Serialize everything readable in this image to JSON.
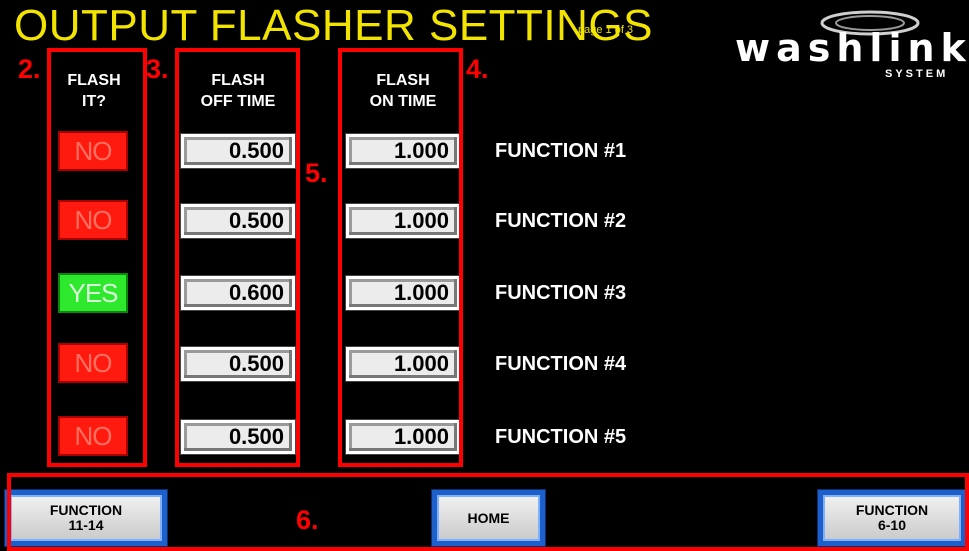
{
  "header": {
    "title": "OUTPUT FLASHER SETTINGS",
    "page_indicator": "page 1 of 3",
    "logo_text": "washlink",
    "logo_subtext": "SYSTEM"
  },
  "columns": {
    "flash_it": [
      "FLASH",
      "IT?"
    ],
    "flash_off": [
      "FLASH",
      "OFF TIME"
    ],
    "flash_on": [
      "FLASH",
      "ON TIME"
    ]
  },
  "rows": [
    {
      "flash_it": "NO",
      "off_time": "0.500",
      "on_time": "1.000",
      "function": "FUNCTION #1"
    },
    {
      "flash_it": "NO",
      "off_time": "0.500",
      "on_time": "1.000",
      "function": "FUNCTION #2"
    },
    {
      "flash_it": "YES",
      "off_time": "0.600",
      "on_time": "1.000",
      "function": "FUNCTION #3"
    },
    {
      "flash_it": "NO",
      "off_time": "0.500",
      "on_time": "1.000",
      "function": "FUNCTION #4"
    },
    {
      "flash_it": "NO",
      "off_time": "0.500",
      "on_time": "1.000",
      "function": "FUNCTION #5"
    }
  ],
  "callouts": {
    "c2": "2.",
    "c3": "3.",
    "c4": "4.",
    "c5": "5.",
    "c6": "6."
  },
  "nav": {
    "prev": [
      "FUNCTION",
      "11-14"
    ],
    "home": "HOME",
    "next": [
      "FUNCTION",
      "6-10"
    ]
  },
  "colors": {
    "no": "#ff1a10",
    "yes": "#2ee82e",
    "title": "#f2e400",
    "callout": "#ff0000"
  }
}
